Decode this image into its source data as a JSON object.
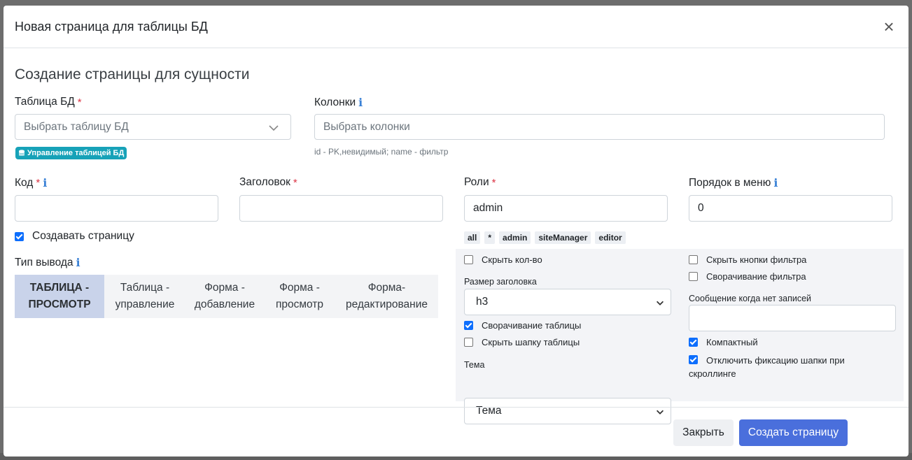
{
  "modal": {
    "title": "Новая страница для таблицы БД",
    "close_glyph": "×"
  },
  "section_title": "Создание страницы для сущности",
  "db_table": {
    "label": "Таблица БД",
    "required_mark": "*",
    "placeholder": "Выбрать таблицу БД",
    "manage_badge": "Управление таблицей БД",
    "badge_icon": "database-icon"
  },
  "columns": {
    "label": "Колонки",
    "info_icon": "i",
    "placeholder": "Выбрать колонки",
    "hint": "id - PK,невидимый; name - фильтр"
  },
  "code": {
    "label": "Код",
    "required_mark": "*",
    "info_icon": "i",
    "value": ""
  },
  "heading": {
    "label": "Заголовок",
    "required_mark": "*",
    "value": ""
  },
  "roles": {
    "label": "Роли",
    "required_mark": "*",
    "value": "admin",
    "chips": [
      "all",
      "*",
      "admin",
      "siteManager",
      "editor"
    ]
  },
  "menu_order": {
    "label": "Порядок в меню",
    "info_icon": "i",
    "value": "0"
  },
  "create_page": {
    "label": "Создавать страницу",
    "checked": true
  },
  "output_type": {
    "label": "Тип вывода",
    "info_icon": "i",
    "tabs": [
      {
        "line1": "ТАБЛИЦА -",
        "line2": "ПРОСМОТР",
        "active": true
      },
      {
        "line1": "Таблица -",
        "line2": "управление",
        "active": false
      },
      {
        "line1": "Форма -",
        "line2": "добавление",
        "active": false
      },
      {
        "line1": "Форма -",
        "line2": "просмотр",
        "active": false
      },
      {
        "line1": "Форма-",
        "line2": "редактирование",
        "active": false
      }
    ]
  },
  "options": {
    "hide_count": {
      "label": "Скрыть кол-во",
      "checked": false
    },
    "header_size": {
      "label": "Размер заголовка",
      "value": "h3"
    },
    "collapse_table": {
      "label": "Сворачивание таблицы",
      "checked": true
    },
    "hide_table_header": {
      "label": "Скрыть шапку таблицы",
      "checked": false
    },
    "theme": {
      "label": "Тема",
      "value": "Тема"
    },
    "hide_filter_buttons": {
      "label": "Скрыть кнопки фильтра",
      "checked": false
    },
    "collapse_filter": {
      "label": "Сворачивание фильтра",
      "checked": false
    },
    "empty_message": {
      "label": "Сообщение когда нет записей",
      "value": ""
    },
    "compact": {
      "label": "Компактный",
      "checked": true
    },
    "disable_sticky_header": {
      "label": "Отключить фиксацию шапки при скроллинге",
      "checked": true
    }
  },
  "footer": {
    "close_label": "Закрыть",
    "create_label": "Создать страницу"
  },
  "colors": {
    "primary": "#4a6fdc",
    "info_badge": "#17a2b8",
    "required": "#dc3545",
    "active_tab": "#c9d3ea"
  }
}
